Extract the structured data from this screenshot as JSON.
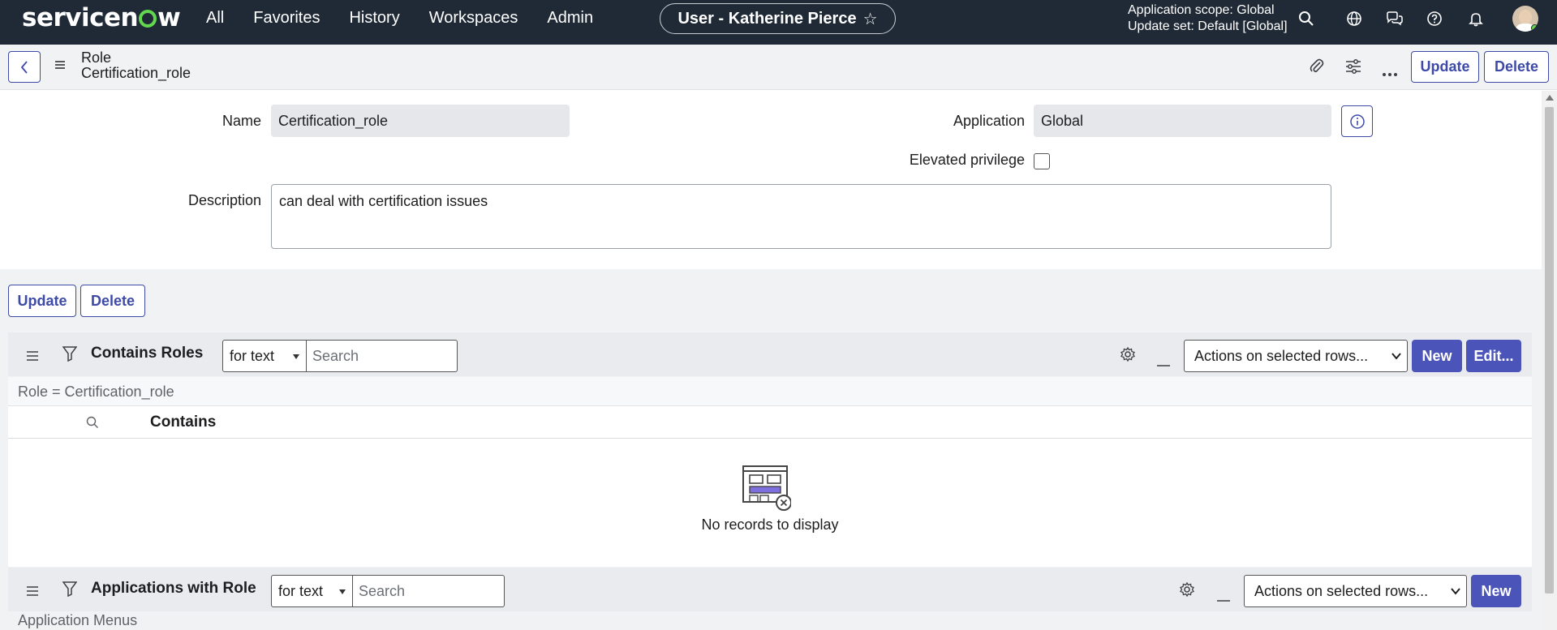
{
  "topnav": {
    "logo_left": "servicen",
    "logo_right": "w",
    "links": [
      "All",
      "Favorites",
      "History",
      "Workspaces",
      "Admin"
    ],
    "user_pill": "User - Katherine Pierce",
    "scope_line1": "Application scope: Global",
    "scope_line2": "Update set: Default [Global]"
  },
  "record_header": {
    "table": "Role",
    "record": "Certification_role",
    "update_label": "Update",
    "delete_label": "Delete"
  },
  "form": {
    "name_label": "Name",
    "name_value": "Certification_role",
    "application_label": "Application",
    "application_value": "Global",
    "elevated_label": "Elevated privilege",
    "elevated_checked": false,
    "description_label": "Description",
    "description_value": "can deal with certification issues"
  },
  "form_buttons": {
    "update_label": "Update",
    "delete_label": "Delete"
  },
  "related_lists": [
    {
      "title": "Contains Roles",
      "search_type": "for text",
      "search_placeholder": "Search",
      "actions_label": "Actions on selected rows...",
      "new_label": "New",
      "edit_label": "Edit...",
      "filter_text": "Role = Certification_role",
      "column": "Contains",
      "empty_text": "No records to display"
    },
    {
      "title": "Applications with Role",
      "search_type": "for text",
      "search_placeholder": "Search",
      "actions_label": "Actions on selected rows...",
      "new_label": "New",
      "sub_text": "Application Menus"
    }
  ],
  "colors": {
    "nav_bg": "#202a36",
    "accent": "#4b55b9",
    "logo_green": "#62d84e"
  }
}
